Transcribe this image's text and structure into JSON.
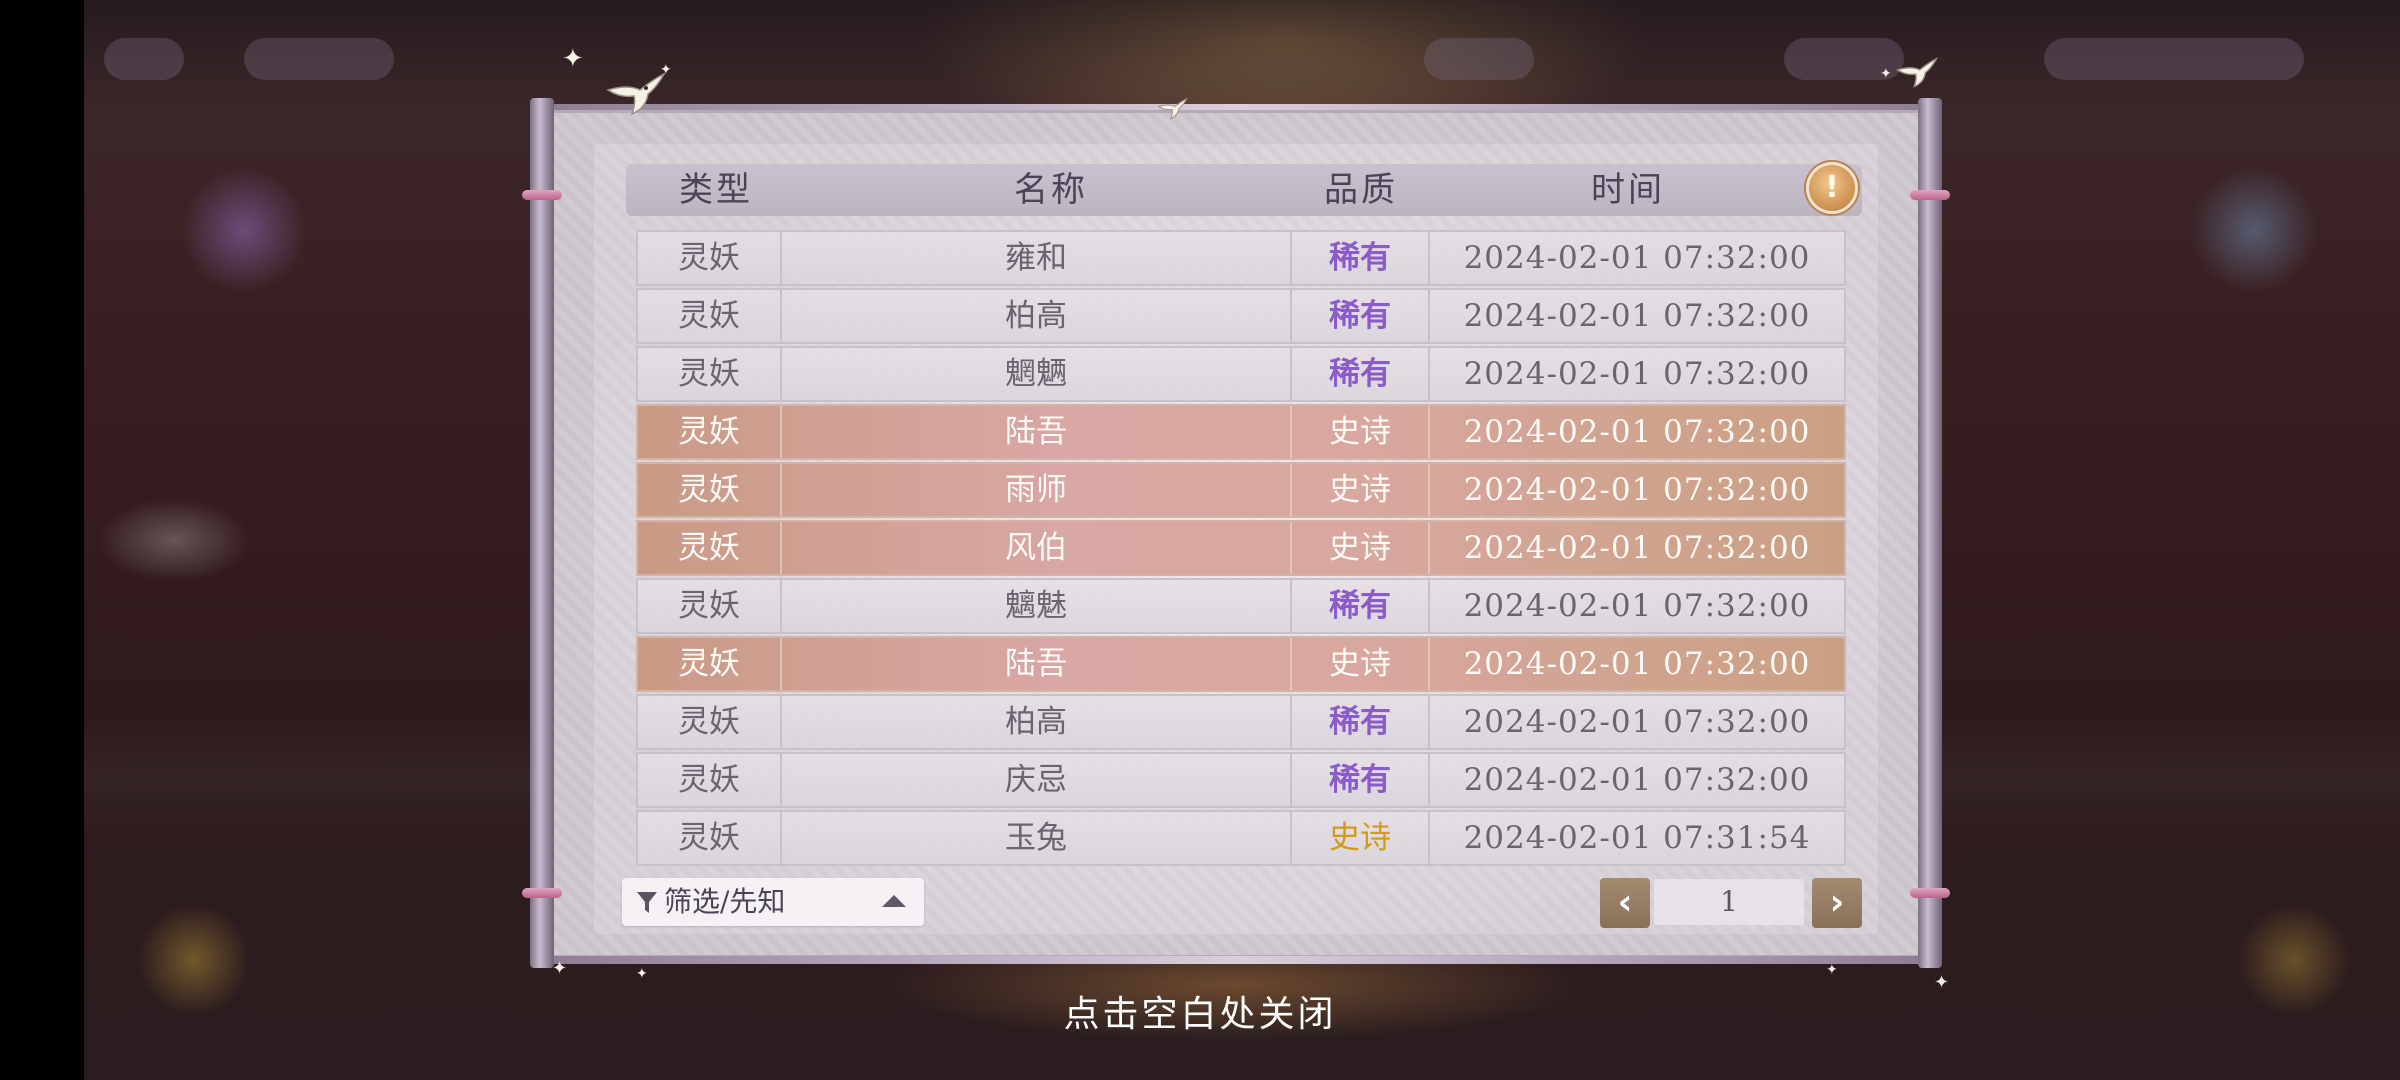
{
  "table": {
    "headers": {
      "type": "类型",
      "name": "名称",
      "quality": "品质",
      "time": "时间"
    },
    "rows": [
      {
        "type": "灵妖",
        "name": "雍和",
        "quality": "稀有",
        "time": "2024-02-01  07:32:00",
        "tier": "rare"
      },
      {
        "type": "灵妖",
        "name": "柏高",
        "quality": "稀有",
        "time": "2024-02-01  07:32:00",
        "tier": "rare"
      },
      {
        "type": "灵妖",
        "name": "魍魉",
        "quality": "稀有",
        "time": "2024-02-01  07:32:00",
        "tier": "rare"
      },
      {
        "type": "灵妖",
        "name": "陆吾",
        "quality": "史诗",
        "time": "2024-02-01  07:32:00",
        "tier": "epic"
      },
      {
        "type": "灵妖",
        "name": "雨师",
        "quality": "史诗",
        "time": "2024-02-01  07:32:00",
        "tier": "epic"
      },
      {
        "type": "灵妖",
        "name": "风伯",
        "quality": "史诗",
        "time": "2024-02-01  07:32:00",
        "tier": "epic"
      },
      {
        "type": "灵妖",
        "name": "魑魅",
        "quality": "稀有",
        "time": "2024-02-01  07:32:00",
        "tier": "rare"
      },
      {
        "type": "灵妖",
        "name": "陆吾",
        "quality": "史诗",
        "time": "2024-02-01  07:32:00",
        "tier": "epic"
      },
      {
        "type": "灵妖",
        "name": "柏高",
        "quality": "稀有",
        "time": "2024-02-01  07:32:00",
        "tier": "rare"
      },
      {
        "type": "灵妖",
        "name": "庆忌",
        "quality": "稀有",
        "time": "2024-02-01  07:32:00",
        "tier": "rare"
      },
      {
        "type": "灵妖",
        "name": "玉兔",
        "quality": "史诗",
        "time": "2024-02-01  07:31:54",
        "tier": "epic-plain"
      }
    ]
  },
  "filter": {
    "label": "筛选/先知",
    "icon": "funnel-icon"
  },
  "pagination": {
    "prev_glyph": "‹",
    "next_glyph": "›",
    "current_page": "1"
  },
  "info_button": {
    "glyph": "!",
    "icon": "info-icon"
  },
  "close_hint": "点击空白处关闭",
  "colors": {
    "rare": "#8a5cc8",
    "epic_gold": "#d29a16",
    "epic_row": "#d8a79e",
    "pager_button": "#9a7f64"
  }
}
